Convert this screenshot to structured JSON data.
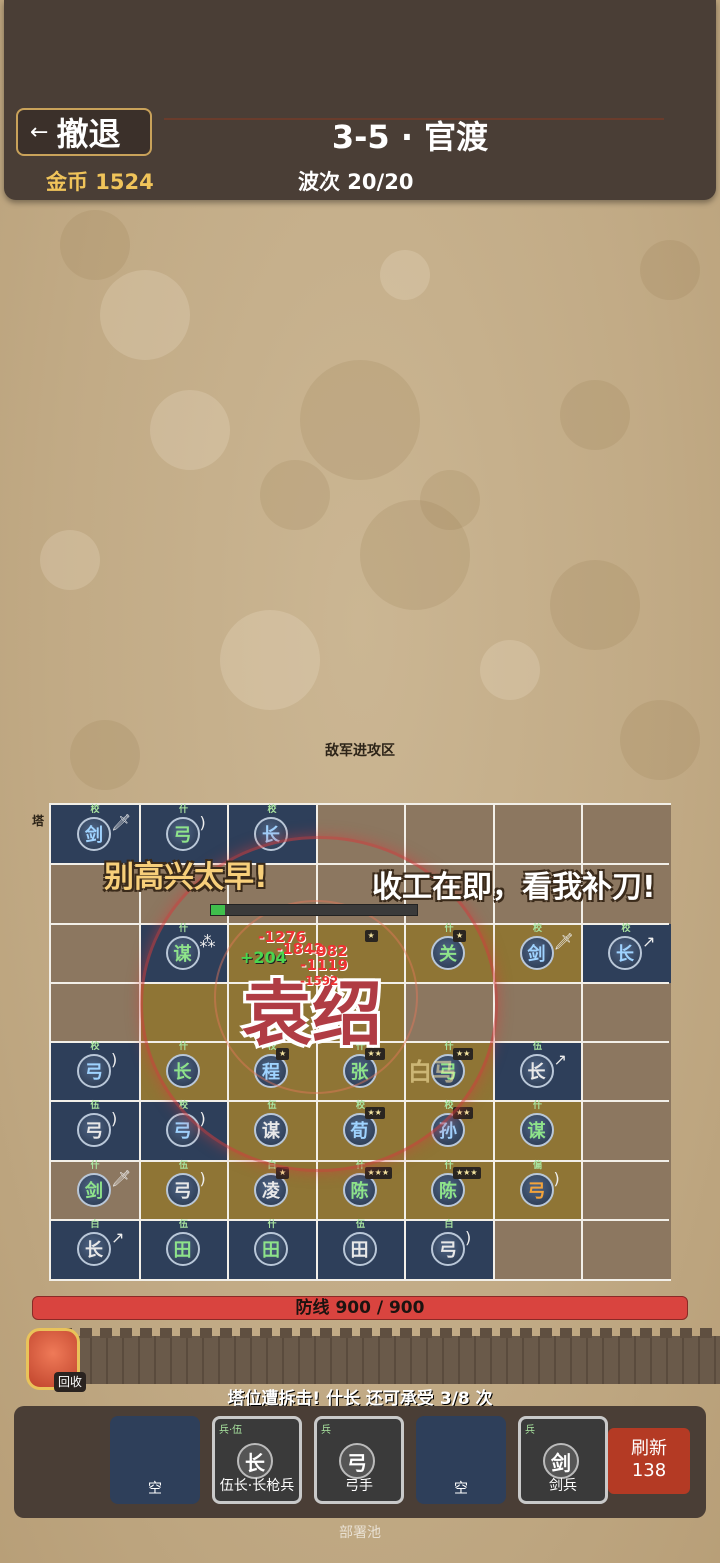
{
  "header": {
    "retreat_label": "撤退",
    "stage_title": "3-5 · 官渡",
    "gold_label": "金币 1524",
    "wave_label": "波次 20/20"
  },
  "field": {
    "zone_label": "敌军进攻区",
    "tower_label": "塔"
  },
  "shouts": {
    "left": "别高兴太早!",
    "right": "收工在即，看我补刀!"
  },
  "boss": {
    "name": "袁绍",
    "hp_fraction": 0.07
  },
  "damage_numbers": [
    "-1276",
    "-1842",
    "-1119",
    "-1592",
    "-982"
  ],
  "heal_number": "+204",
  "ghost_text": "白马",
  "units": [
    {
      "row": 0,
      "col": 0,
      "char": "剑",
      "rank": "校",
      "color": "blue",
      "weapon": "sword"
    },
    {
      "row": 0,
      "col": 1,
      "char": "弓",
      "rank": "什",
      "color": "green",
      "weapon": "bow"
    },
    {
      "row": 0,
      "col": 2,
      "char": "长",
      "rank": "校",
      "color": "blue",
      "weapon": ""
    },
    {
      "row": 2,
      "col": 1,
      "char": "谋",
      "rank": "什",
      "color": "green",
      "weapon": "fan"
    },
    {
      "row": 2,
      "col": 4,
      "char": "关",
      "rank": "什",
      "color": "green",
      "weapon": ""
    },
    {
      "row": 2,
      "col": 5,
      "char": "剑",
      "rank": "校",
      "color": "blue",
      "weapon": "sword"
    },
    {
      "row": 2,
      "col": 6,
      "char": "长",
      "rank": "校",
      "color": "blue",
      "weapon": "spear"
    },
    {
      "row": 4,
      "col": 0,
      "char": "弓",
      "rank": "校",
      "color": "blue",
      "weapon": "bow"
    },
    {
      "row": 4,
      "col": 1,
      "char": "长",
      "rank": "什",
      "color": "green",
      "weapon": ""
    },
    {
      "row": 4,
      "col": 2,
      "char": "程",
      "rank": "校",
      "color": "blue",
      "weapon": ""
    },
    {
      "row": 4,
      "col": 3,
      "char": "张",
      "rank": "什",
      "color": "green",
      "weapon": ""
    },
    {
      "row": 4,
      "col": 4,
      "char": "弓",
      "rank": "什",
      "color": "green",
      "weapon": ""
    },
    {
      "row": 4,
      "col": 5,
      "char": "长",
      "rank": "伍",
      "color": "gray",
      "weapon": "spear"
    },
    {
      "row": 5,
      "col": 0,
      "char": "弓",
      "rank": "伍",
      "color": "gray",
      "weapon": "bow"
    },
    {
      "row": 5,
      "col": 1,
      "char": "弓",
      "rank": "校",
      "color": "blue",
      "weapon": "bow"
    },
    {
      "row": 5,
      "col": 2,
      "char": "谋",
      "rank": "伍",
      "color": "gray",
      "weapon": ""
    },
    {
      "row": 5,
      "col": 3,
      "char": "荀",
      "rank": "校",
      "color": "blue",
      "weapon": ""
    },
    {
      "row": 5,
      "col": 4,
      "char": "孙",
      "rank": "校",
      "color": "blue",
      "weapon": ""
    },
    {
      "row": 5,
      "col": 5,
      "char": "谋",
      "rank": "什",
      "color": "green",
      "weapon": ""
    },
    {
      "row": 6,
      "col": 0,
      "char": "剑",
      "rank": "什",
      "color": "green",
      "weapon": "sword"
    },
    {
      "row": 6,
      "col": 1,
      "char": "弓",
      "rank": "伍",
      "color": "gray",
      "weapon": "bow"
    },
    {
      "row": 6,
      "col": 2,
      "char": "凌",
      "rank": "白",
      "color": "gray",
      "weapon": ""
    },
    {
      "row": 6,
      "col": 3,
      "char": "陈",
      "rank": "什",
      "color": "green",
      "weapon": ""
    },
    {
      "row": 6,
      "col": 4,
      "char": "陈",
      "rank": "什",
      "color": "green",
      "weapon": ""
    },
    {
      "row": 6,
      "col": 5,
      "char": "弓",
      "rank": "偏",
      "color": "orange",
      "weapon": "bow"
    },
    {
      "row": 7,
      "col": 0,
      "char": "长",
      "rank": "白",
      "color": "gray",
      "weapon": "spear"
    },
    {
      "row": 7,
      "col": 1,
      "char": "田",
      "rank": "伍",
      "color": "green",
      "weapon": ""
    },
    {
      "row": 7,
      "col": 2,
      "char": "田",
      "rank": "什",
      "color": "green",
      "weapon": ""
    },
    {
      "row": 7,
      "col": 3,
      "char": "田",
      "rank": "伍",
      "color": "gray",
      "weapon": ""
    },
    {
      "row": 7,
      "col": 4,
      "char": "弓",
      "rank": "白",
      "color": "gray",
      "weapon": "bow"
    }
  ],
  "star_badges": [
    {
      "row": 2,
      "col": 3,
      "stars": "★"
    },
    {
      "row": 2,
      "col": 4,
      "stars": "★"
    },
    {
      "row": 4,
      "col": 2,
      "stars": "★"
    },
    {
      "row": 4,
      "col": 3,
      "stars": "★★"
    },
    {
      "row": 4,
      "col": 4,
      "stars": "★★"
    },
    {
      "row": 5,
      "col": 3,
      "stars": "★★"
    },
    {
      "row": 5,
      "col": 4,
      "stars": "★★"
    },
    {
      "row": 6,
      "col": 2,
      "stars": "★"
    },
    {
      "row": 6,
      "col": 3,
      "stars": "★★★"
    },
    {
      "row": 6,
      "col": 4,
      "stars": "★★★"
    }
  ],
  "defense": {
    "label": "防线 900 / 900",
    "fraction": 1.0
  },
  "recycle_label": "回收",
  "status_text": "塔位遭拆击! 什长 还可承受 3/8 次",
  "pool": {
    "slots": [
      {
        "name": "空",
        "char": "",
        "tag": "",
        "filled": false
      },
      {
        "name": "伍长·长枪兵",
        "char": "长",
        "tag": "兵·伍",
        "filled": true
      },
      {
        "name": "弓手",
        "char": "弓",
        "tag": "兵",
        "filled": true
      },
      {
        "name": "空",
        "char": "",
        "tag": "",
        "filled": false
      },
      {
        "name": "剑兵",
        "char": "剑",
        "tag": "兵",
        "filled": true
      }
    ],
    "refresh_label": "刷新",
    "refresh_cost": "138",
    "label": "部署池"
  }
}
